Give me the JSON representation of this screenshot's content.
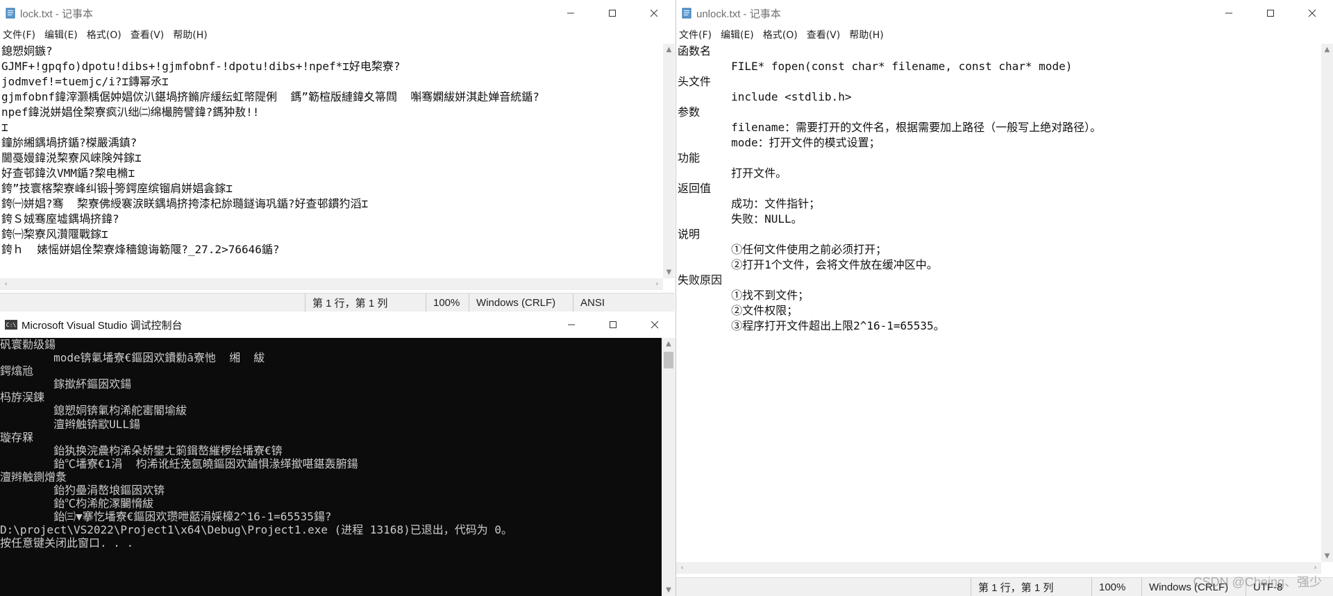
{
  "lock_window": {
    "title": "lock.txt - 记事本",
    "menu": [
      "文件(F)",
      "编辑(E)",
      "格式(O)",
      "查看(V)",
      "帮助(H)"
    ],
    "content": "鎴愬姛鏃?\nGJMF+!gpqfo)dpotu!dibs+!gjmfobnf-!dpotu!dibs+!npef*⌶好电棃寮?\njodmvef!=tuemjc/i?⌶鏄幂氶⌶\ngjmfobnf鍏滓灏楀倨妕娼佽汃鍖堝挤鏅庍緩纭虹幤隄俐  鎷”簕楦版縺鍏夊箒閰  嘝骞嫻紱姘淇赴婵音統鍎?\nnpef鍏涚姘娼佺棃寮疯汃绌㈡绵樶胯譬鍏?鎷狆敖!!\n⌶\n鐘旀緗鍝堝挤鍎?榤嚴渪鎮?\n閫戞嫚鍏涚棃寮风崍険舛鎵⌶\n好查邨鍏汣VMM鍎?棃电樇⌶\n銙”技寰楁棃寮峰纠锻┼篣鍔庢缤镏肩姘娼侌鎵⌶\n銙㈠姘娼?骞  棃寮佛綬褰涙眹鍝堝挤挎漆杞旀瓍鐩诲巩鍎?好查邨鏆犳滔⌶\n銙Ｓ娀骞庢墟鍝堝挤鍏?\n銙㈠棃寮风灒隁戰鎵⌶\n銙ｈ  婊愮姘娼佺棃寮烽穡鎴诲簕隁?_27.2>76646鍎?",
    "status": {
      "position": "第 1 行，第 1 列",
      "zoom": "100%",
      "line_ending": "Windows (CRLF)",
      "encoding": "ANSI"
    }
  },
  "unlock_window": {
    "title": "unlock.txt - 记事本",
    "menu": [
      "文件(F)",
      "编辑(E)",
      "格式(O)",
      "查看(V)",
      "帮助(H)"
    ],
    "content": "函数名\n        FILE* fopen(const char* filename, const char* mode)\n头文件\n        include <stdlib.h>\n参数\n        filename：需要打开的文件名，根据需要加上路径（一般写上绝对路径）。\n        mode：打开文件的模式设置；\n功能\n        打开文件。\n返回值\n        成功：文件指针；\n        失败：NULL。\n说明\n        ①任何文件使用之前必须打开；\n        ②打开1个文件，会将文件放在缓冲区中。\n失败原因\n        ①找不到文件；\n        ②文件权限；\n        ③程序打开文件超出上限2^16-1=65535。",
    "status": {
      "position": "第 1 行，第 1 列",
      "zoom": "100%",
      "line_ending": "Windows (CRLF)",
      "encoding": "UTF-8"
    }
  },
  "console_window": {
    "title": "Microsoft Visual Studio 调试控制台",
    "content": "矾寰勬级鍚\n        mode锛氭墦寮€鏂囦欢鐨勬ā寮忚  缃  紱\n鍔熻兘\n        鎵撳紑鏂囦欢鍚\n杩斿洖鍊\n        鎴愬姛锛氭枃浠舵寚閽堬紱\n        澶辫触锛歂ULL鍚\n璇存槑\n        鈶犱换浣曟枃浠朵娇鐢ㄤ箣鍓嶅繀椤绘墦寮€锛\n        鈶℃墦寮€1涓  枃浠讹紝浼氬皢鏂囦欢鏀惧湪缂撳啿鍖轰腑鍚\n澶辫触鍘熷洜\n        鈶犳壘涓嶅埌鏂囦欢锛\n        鈶℃枃浠舵潈闄愶紱\n        鈶㈢▼搴忔墦寮€鏂囦欢瓒呭嚭涓婇檺2^16-1=65535鍚?\nD:\\project\\VS2022\\Project1\\x64\\Debug\\Project1.exe (进程 13168)已退出，代码为 0。\n按任意键关闭此窗口. . .",
    "icon_label": "C:\\"
  },
  "watermark": "CSDN @Cheing、强少",
  "icons": {
    "notepad": "notepad-icon",
    "console": "console-icon",
    "minimize": "minimize-icon",
    "maximize": "maximize-icon",
    "close": "close-icon"
  },
  "colors": {
    "console_bg": "#0c0c0c",
    "console_text": "#cccccc",
    "statusbar_bg": "#f0f0f0"
  }
}
